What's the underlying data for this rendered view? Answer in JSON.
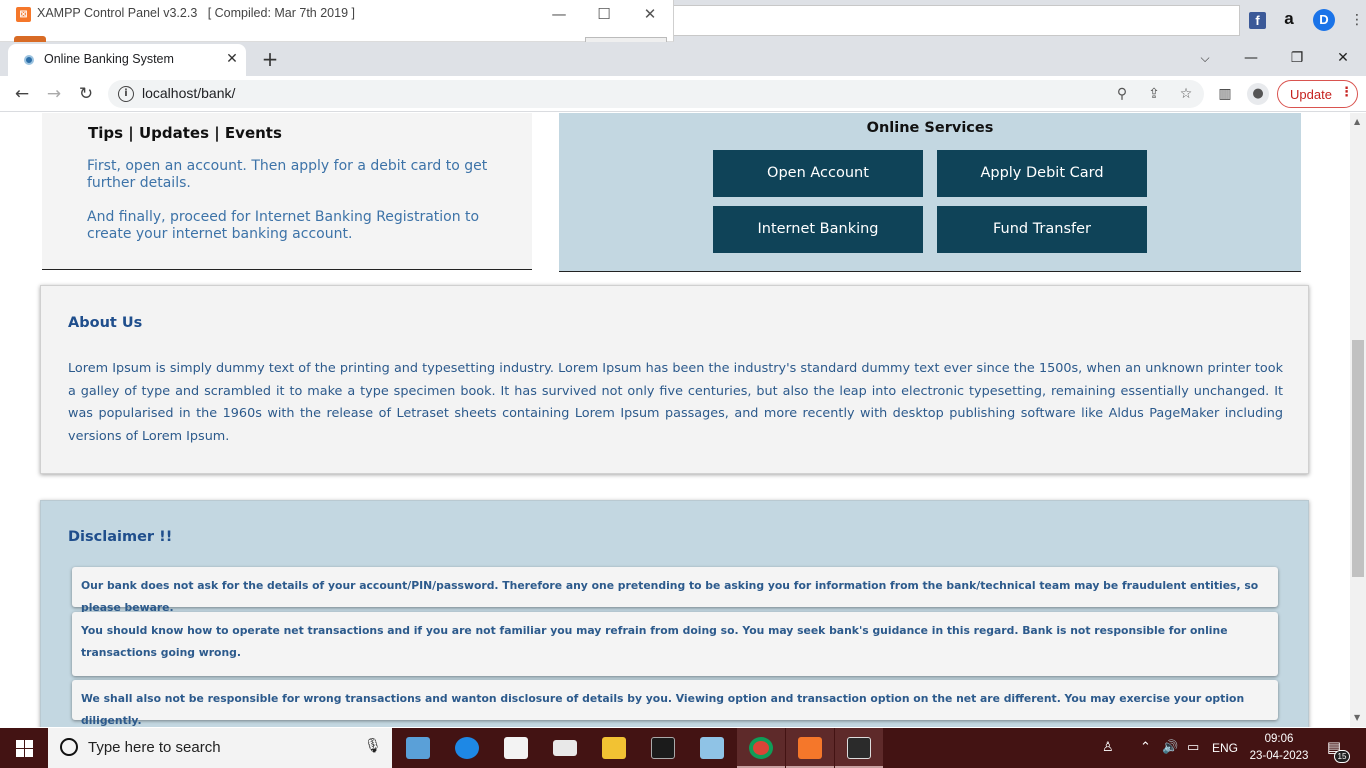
{
  "xampp": {
    "title": "XAMPP Control Panel v3.2.3   [ Compiled: Mar 7th 2019 ]",
    "logo": "xampp-logo-icon"
  },
  "browser": {
    "tab_title": "Online Banking System",
    "url": "localhost/bank/",
    "update_label": "Update"
  },
  "page": {
    "tips": {
      "title": "Tips | Updates | Events",
      "p1": "First, open an account. Then apply for a debit card to get further details.",
      "p2": "And finally, proceed for Internet Banking Registration to create your internet banking account."
    },
    "services": {
      "title": "Online Services",
      "buttons": [
        "Open Account",
        "Apply Debit Card",
        "Internet Banking",
        "Fund Transfer"
      ]
    },
    "about": {
      "title": "About Us",
      "text": "Lorem Ipsum is simply dummy text of the printing and typesetting industry. Lorem Ipsum has been the industry's standard dummy text ever since the 1500s, when an unknown printer took a galley of type and scrambled it to make a type specimen book. It has survived not only five centuries, but also the leap into electronic typesetting, remaining essentially unchanged. It was popularised in the 1960s with the release of Letraset sheets containing Lorem Ipsum passages, and more recently with desktop publishing software like Aldus PageMaker including versions of Lorem Ipsum."
    },
    "disclaimer": {
      "title": "Disclaimer !!",
      "items": [
        "Our bank does not ask for the details of your account/PIN/password. Therefore any one pretending to be asking you for information from the bank/technical team may be fraudulent entities, so please beware.",
        "You should know how to operate net transactions and if you are not familiar you may refrain from doing so. You may seek bank's guidance in this regard. Bank is not responsible for online transactions going wrong.",
        "We shall also not be responsible for wrong transactions and wanton disclosure of details by you. Viewing option and transaction option on the net are different. You may exercise your option diligently."
      ]
    }
  },
  "taskbar": {
    "search_placeholder": "Type here to search",
    "language": "ENG",
    "time": "09:06",
    "date": "23-04-2023",
    "notification_count": "15"
  },
  "colors": {
    "services_bg": "#c3d7e1",
    "button_bg": "#0f4358",
    "heading_blue": "#1f4e8c",
    "taskbar_bg": "#431313"
  }
}
